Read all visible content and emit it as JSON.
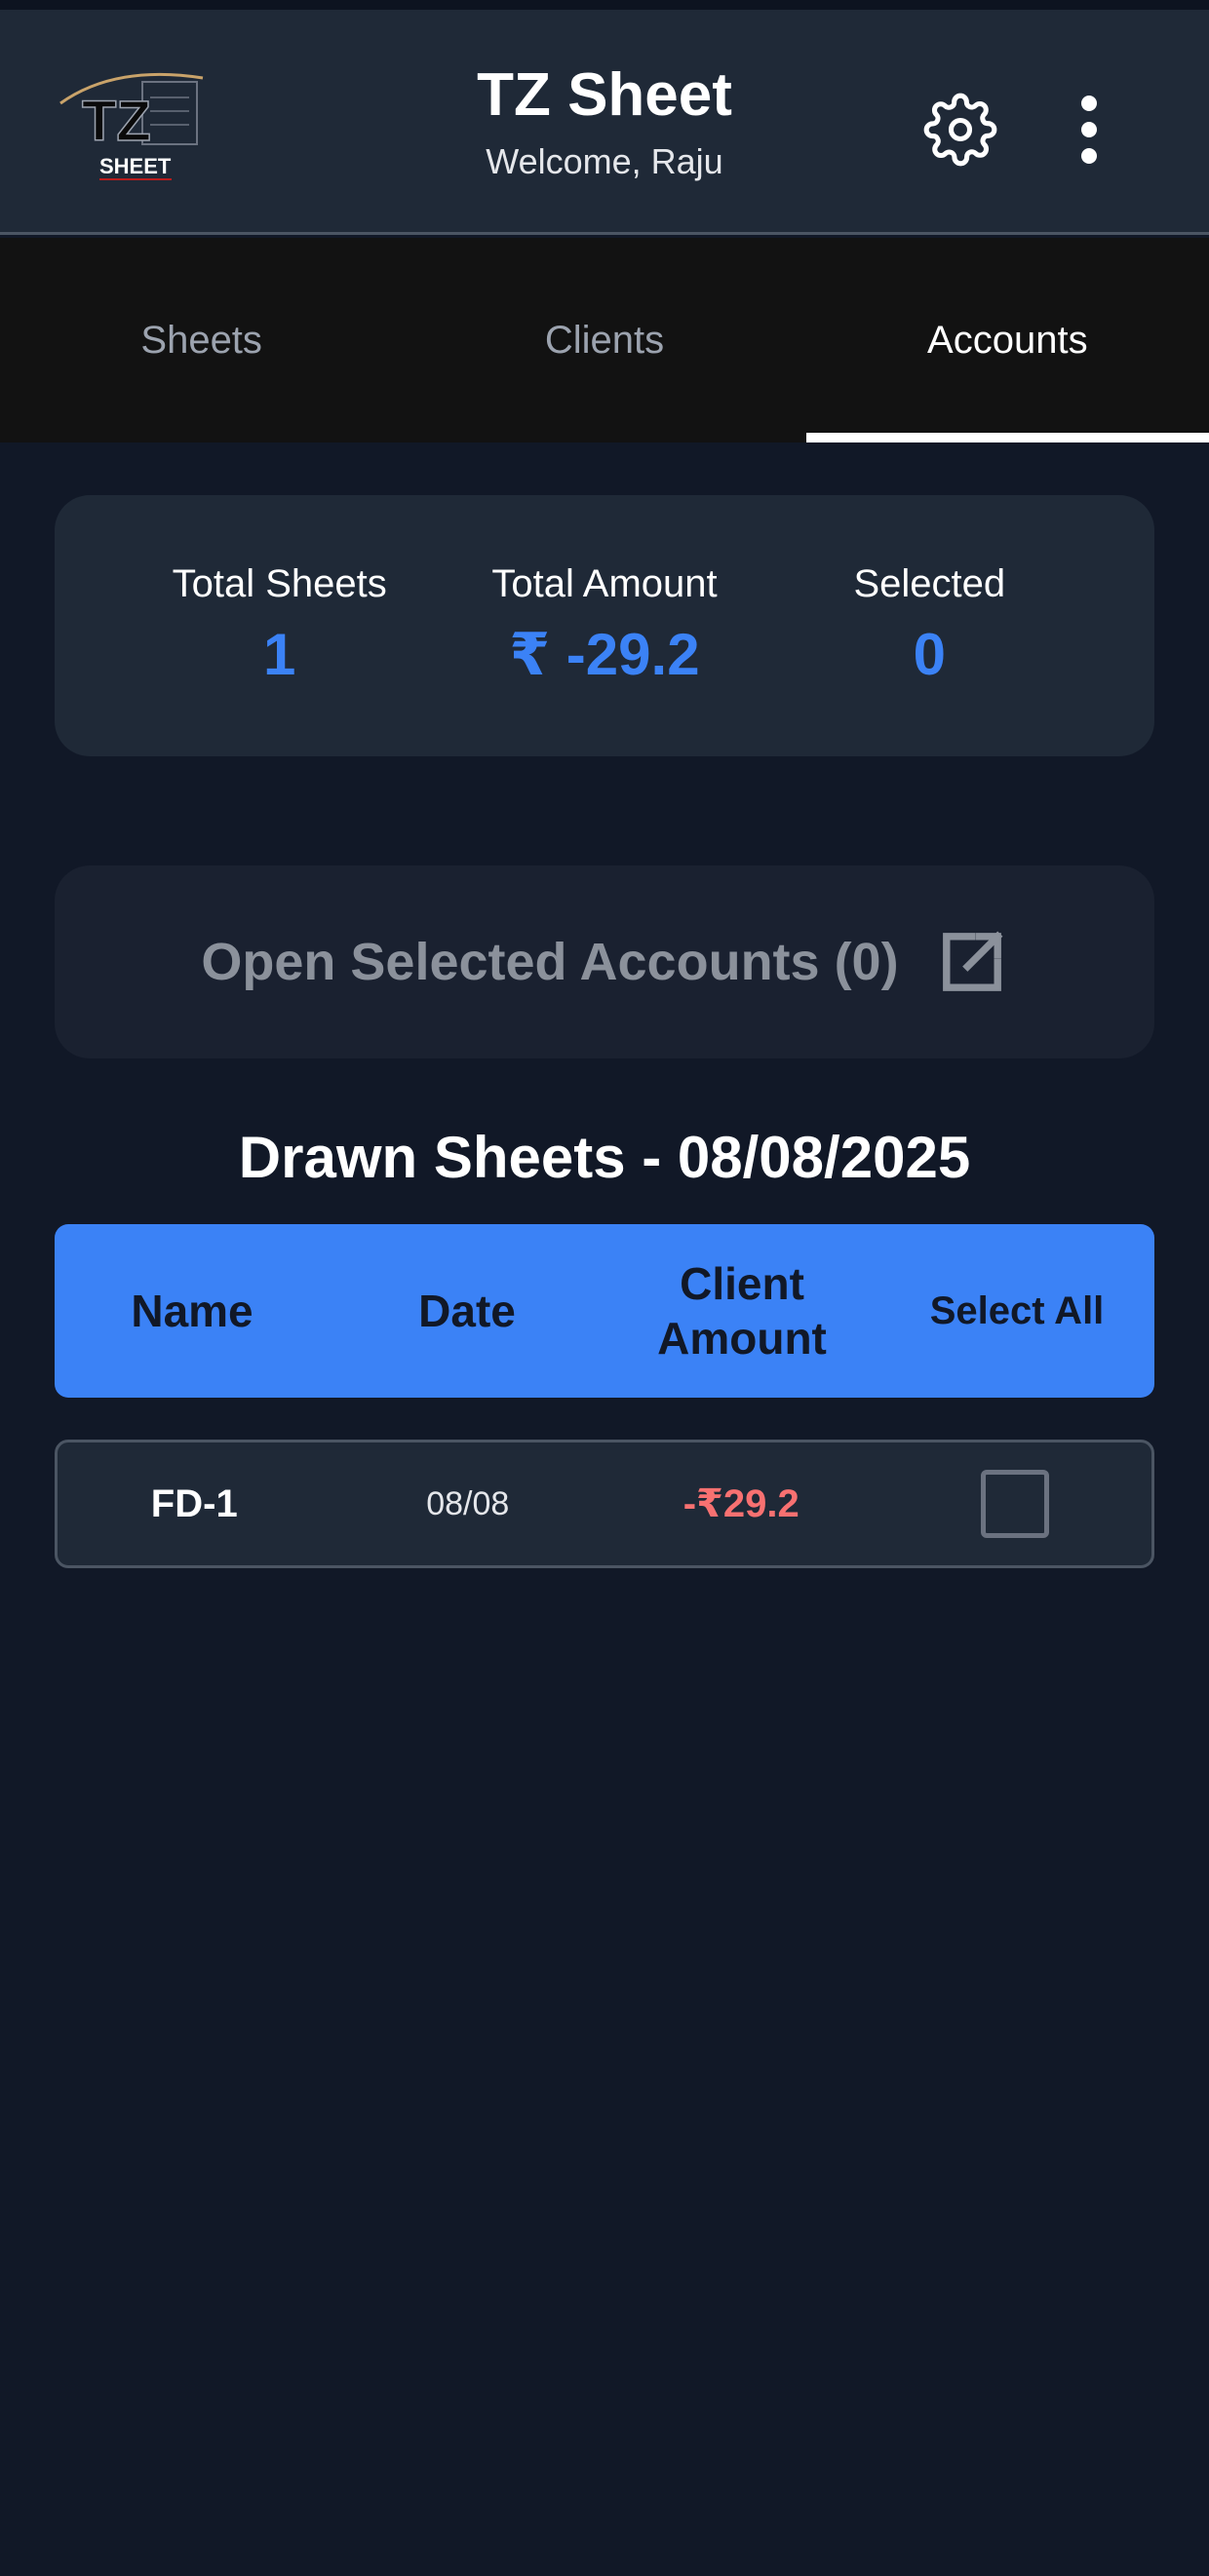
{
  "header": {
    "title": "TZ Sheet",
    "subtitle": "Welcome, Raju",
    "logo_text": "TZ",
    "logo_subtext": "SHEET",
    "settings_icon": "gear-icon",
    "more_icon": "more-vertical-icon"
  },
  "tabs": [
    {
      "label": "Sheets",
      "active": false
    },
    {
      "label": "Clients",
      "active": false
    },
    {
      "label": "Accounts",
      "active": true
    }
  ],
  "stats": {
    "total_sheets_label": "Total Sheets",
    "total_sheets_value": "1",
    "total_amount_label": "Total Amount",
    "total_amount_value": "₹ -29.2",
    "selected_label": "Selected",
    "selected_value": "0"
  },
  "open_button": {
    "label": "Open Selected Accounts (0)",
    "icon": "external-link-icon"
  },
  "section_title": "Drawn Sheets - 08/08/2025",
  "table": {
    "headers": {
      "name": "Name",
      "date": "Date",
      "client_amount_line1": "Client",
      "client_amount_line2": "Amount",
      "select_all": "Select All"
    },
    "rows": [
      {
        "name": "FD-1",
        "date": "08/08",
        "amount": "-₹29.2",
        "checked": false
      }
    ]
  },
  "colors": {
    "background": "#111827",
    "card": "#1f2937",
    "accent": "#3b82f6",
    "negative": "#f87171"
  }
}
